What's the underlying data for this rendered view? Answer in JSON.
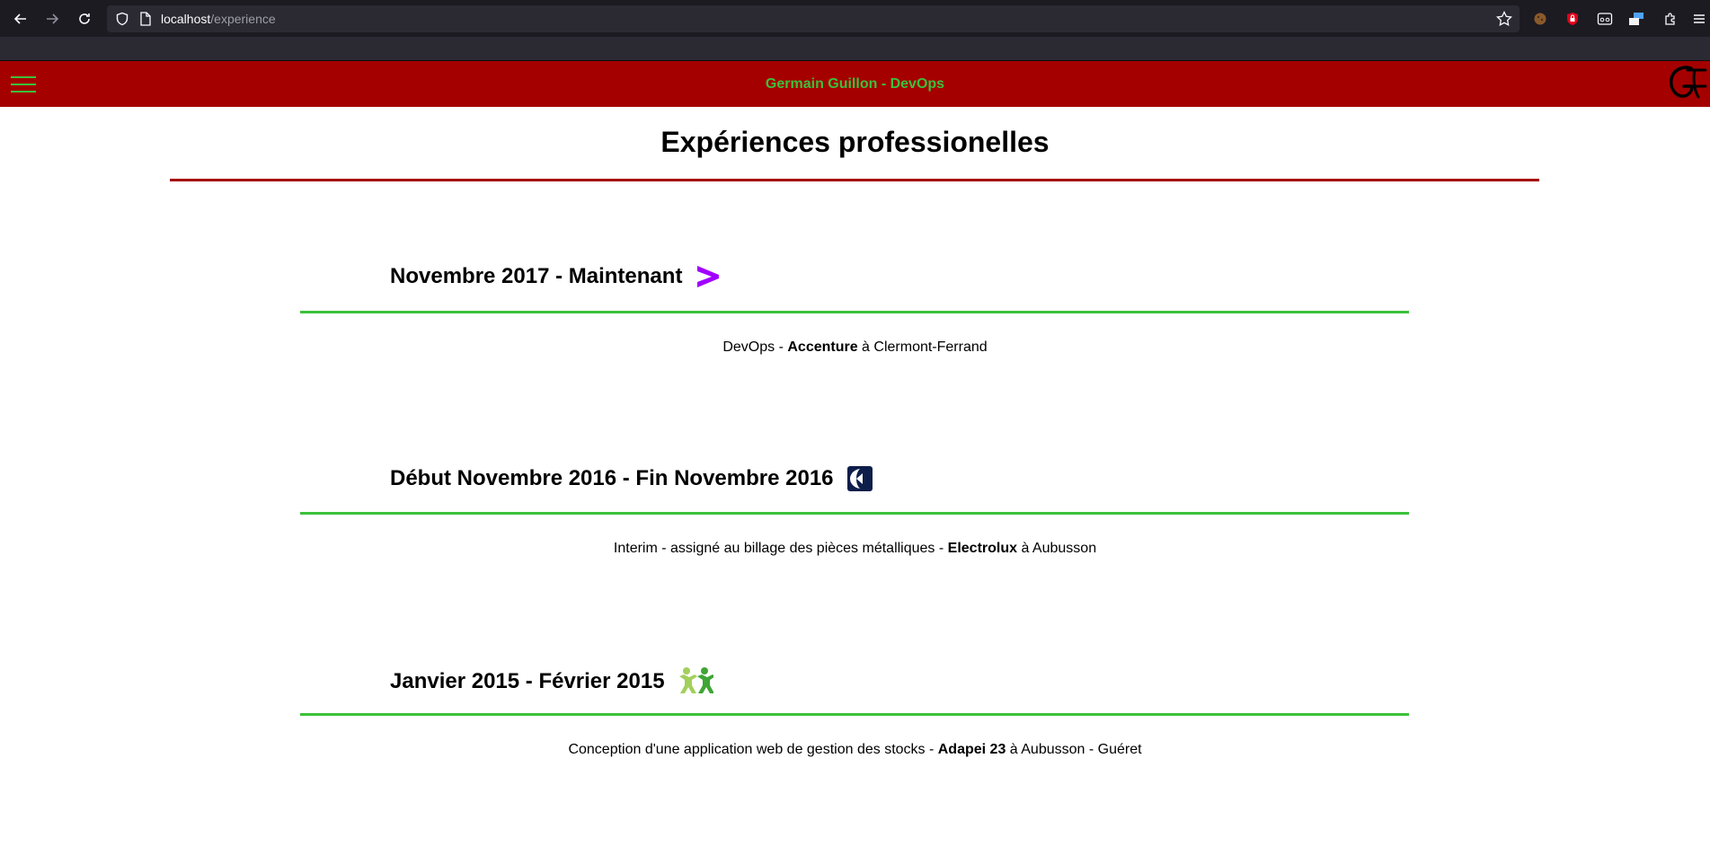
{
  "browser": {
    "url_host": "localhost",
    "url_path": "/experience"
  },
  "header": {
    "title": "Germain Guillon - DevOps",
    "title_color": "#3bc13b",
    "bg_color": "#a50000"
  },
  "page": {
    "title": "Expériences professionelles"
  },
  "experiences": [
    {
      "period": "Novembre 2017 - Maintenant",
      "logo": "accenture-logo",
      "role": "DevOps - ",
      "company": "Accenture",
      "location": " à Clermont-Ferrand"
    },
    {
      "period": "Début Novembre 2016 - Fin Novembre 2016",
      "logo": "electrolux-logo",
      "role": "Interim - assigné au billage des pièces métalliques - ",
      "company": "Electrolux",
      "location": " à Aubusson"
    },
    {
      "period": "Janvier 2015 - Février 2015",
      "logo": "adapei-logo",
      "role": "Conception d'une application web de gestion des stocks - ",
      "company": "Adapei 23",
      "location": " à Aubusson - Guéret"
    }
  ]
}
